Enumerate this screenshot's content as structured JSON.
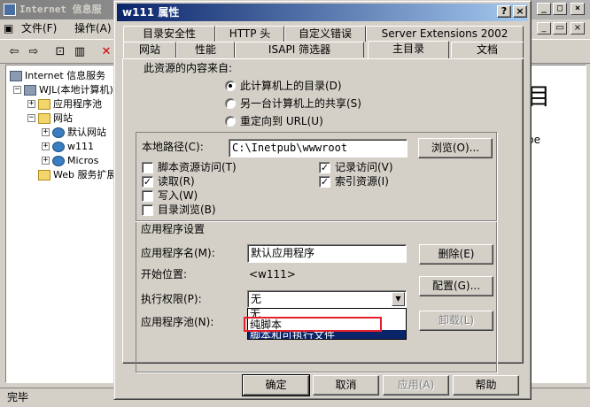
{
  "bg": {
    "title": "Internet 信息服",
    "menu": {
      "file": "文件(F)",
      "action": "操作(A)"
    },
    "tree": {
      "root": "Internet 信息服务",
      "computer": "WJL(本地计算机)",
      "app_pools": "应用程序池",
      "websites": "网站",
      "default_site": "默认网站",
      "w111": "w111",
      "micros": "Micros",
      "web_ext": "Web 服务扩展"
    },
    "right_partial_1": "目",
    "right_partial_2": "be",
    "status": "完毕"
  },
  "dialog": {
    "title": "w111 属性",
    "help_btn": "?",
    "close_btn": "×",
    "tabs_row1": [
      "目录安全性",
      "HTTP 头",
      "自定义错误",
      "Server Extensions 2002"
    ],
    "tabs_row2": [
      "网站",
      "性能",
      "ISAPI 筛选器",
      "主目录",
      "文档"
    ],
    "content_source_label": "此资源的内容来自:",
    "radio_local": "此计算机上的目录(D)",
    "radio_share": "另一台计算机上的共享(S)",
    "radio_redirect": "重定向到 URL(U)",
    "local_path_label": "本地路径(C):",
    "local_path_value": "C:\\Inetpub\\wwwroot",
    "browse_btn": "浏览(O)...",
    "cb_script": "脚本资源访问(T)",
    "cb_read": "读取(R)",
    "cb_write": "写入(W)",
    "cb_dir_browse": "目录浏览(B)",
    "cb_log": "记录访问(V)",
    "cb_index": "索引资源(I)",
    "app_settings_label": "应用程序设置",
    "app_name_label": "应用程序名(M):",
    "app_name_value": "默认应用程序",
    "remove_btn": "删除(E)",
    "start_pos_label": "开始位置:",
    "start_pos_value": "<w111>",
    "config_btn": "配置(G)...",
    "exec_perm_label": "执行权限(P):",
    "exec_perm_value": "无",
    "exec_options": [
      "无",
      "纯脚本",
      "脚本和可执行文件"
    ],
    "app_pool_label": "应用程序池(N):",
    "unload_btn": "卸载(L)",
    "ok_btn": "确定",
    "cancel_btn": "取消",
    "apply_btn": "应用(A)",
    "help_btn2": "帮助"
  },
  "colors": {
    "titlebar_active": "#0a246a",
    "highlight": "#e5202a",
    "face": "#d4d0c8"
  }
}
